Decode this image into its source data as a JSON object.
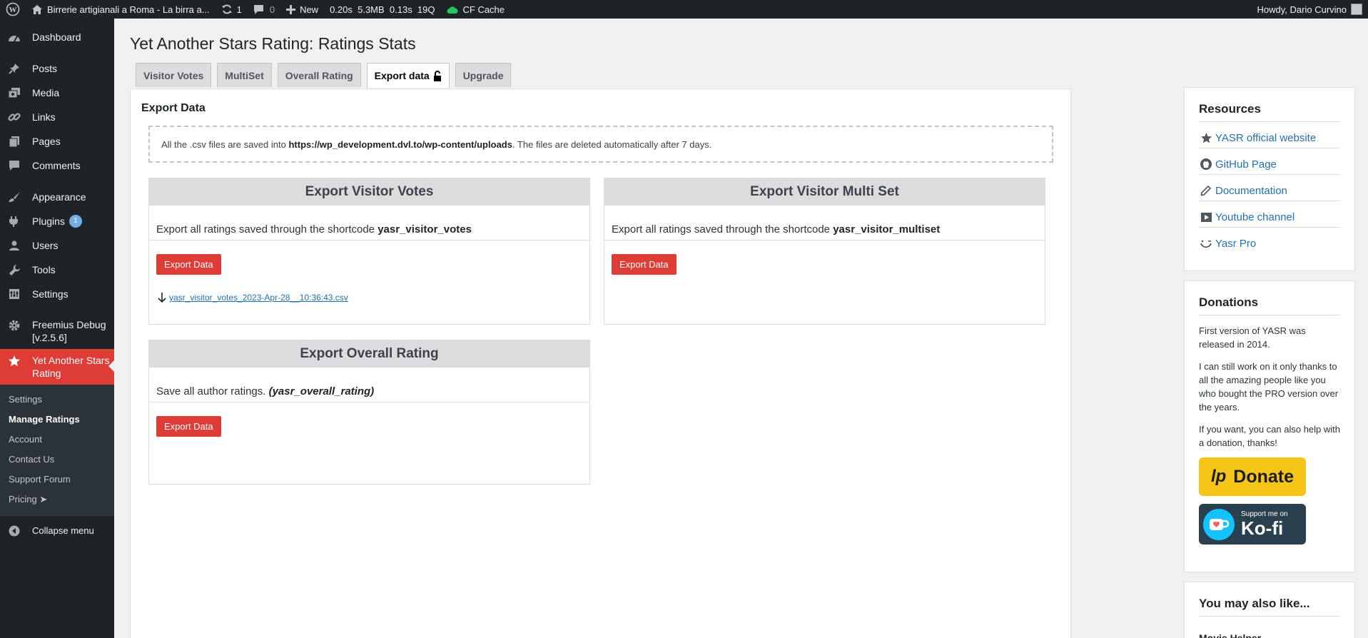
{
  "adminbar": {
    "site_name": "Birrerie artigianali a Roma - La birra a...",
    "updates_count": "1",
    "comments_count": "0",
    "new_label": "New",
    "stats": "0.20s  5.3MB  0.13s  19Q",
    "cf_cache": "CF Cache",
    "howdy": "Howdy, Dario Curvino"
  },
  "sidebar": {
    "dashboard": "Dashboard",
    "posts": "Posts",
    "media": "Media",
    "links": "Links",
    "pages": "Pages",
    "comments": "Comments",
    "appearance": "Appearance",
    "plugins": "Plugins",
    "plugins_badge": "1",
    "users": "Users",
    "tools": "Tools",
    "settings": "Settings",
    "freemius": "Freemius Debug [v.2.5.6]",
    "yasr": "Yet Another Stars Rating",
    "submenu": {
      "settings": "Settings",
      "manage_ratings": "Manage Ratings",
      "account": "Account",
      "contact_us": "Contact Us",
      "support_forum": "Support Forum",
      "pricing": "Pricing ➤"
    },
    "collapse": "Collapse menu"
  },
  "page": {
    "title": "Yet Another Stars Rating: Ratings Stats",
    "tabs": {
      "visitor_votes": "Visitor Votes",
      "multiset": "MultiSet",
      "overall_rating": "Overall Rating",
      "export_data": "Export data",
      "upgrade": "Upgrade"
    },
    "panel_title": "Export Data",
    "notice": {
      "prefix": "All the .csv files are saved into ",
      "path": "https://wp_development.dvl.to/wp-content/uploads",
      "suffix": ". The files are deleted automatically after 7 days."
    },
    "export_button": "Export Data",
    "cards": {
      "visitor_votes": {
        "title": "Export Visitor Votes",
        "desc": "Export all ratings saved through the shortcode ",
        "shortcode": "yasr_visitor_votes",
        "csv": "yasr_visitor_votes_2023-Apr-28__10:36:43.csv"
      },
      "multiset": {
        "title": "Export Visitor Multi Set",
        "desc": "Export all ratings saved through the shortcode ",
        "shortcode": "yasr_visitor_multiset"
      },
      "overall": {
        "title": "Export Overall Rating",
        "desc": "Save all author ratings. ",
        "shortcode": "(yasr_overall_rating)"
      }
    }
  },
  "right": {
    "resources": {
      "title": "Resources",
      "items": [
        "YASR official website",
        "GitHub Page",
        "Documentation",
        "Youtube channel",
        "Yasr Pro"
      ]
    },
    "donations": {
      "title": "Donations",
      "p1": "First version of YASR was released in 2014.",
      "p2": "I can still work on it only thanks to all the amazing people like you who bought the PRO version over the years.",
      "p3": "If you want, you can also help with a donation, thanks!",
      "donate_logo": "lp",
      "donate_label": "Donate",
      "kofi_small": "Support me on",
      "kofi_big": "Ko-fi"
    },
    "also": {
      "title": "You may also like...",
      "item": "Movie Helper"
    }
  },
  "colors": {
    "accent_red": "#dd3d36",
    "admin_dark": "#1d2327",
    "link_blue": "#2271b1",
    "donate_yellow": "#f5c518",
    "kofi_dark": "#29414f"
  }
}
